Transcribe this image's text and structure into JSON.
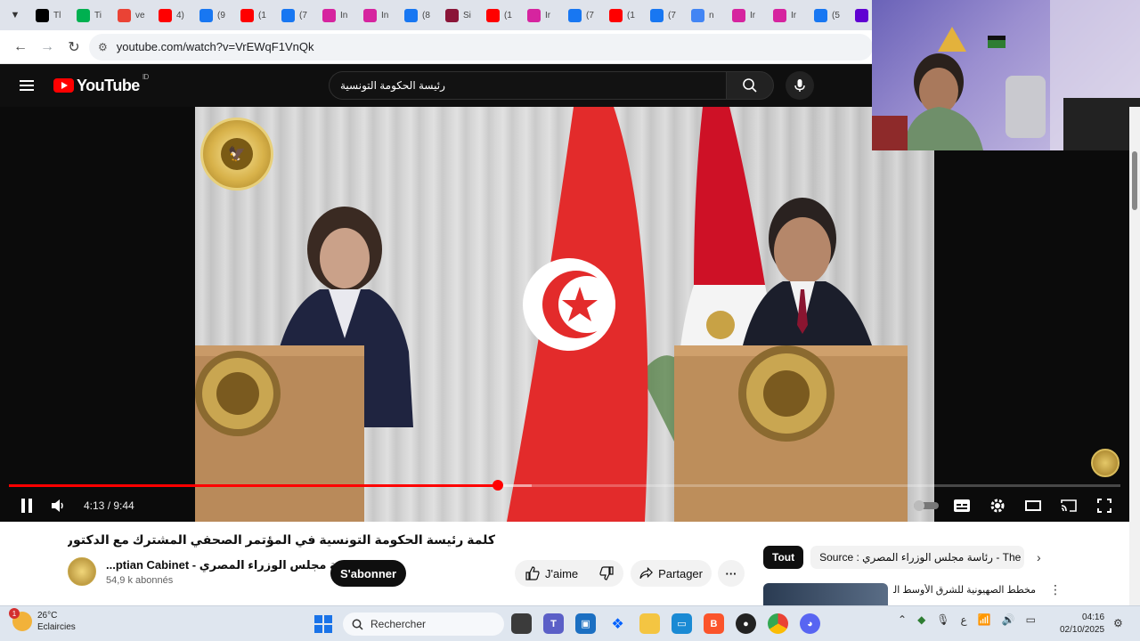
{
  "browser": {
    "tabs": [
      {
        "label": "Tl",
        "icon": "tiktok-icon",
        "color": "#000000"
      },
      {
        "label": "Ti",
        "icon": "k-icon",
        "color": "#00b050"
      },
      {
        "label": "ve",
        "icon": "gmail-icon",
        "color": "#ea4335"
      },
      {
        "label": "4)",
        "icon": "youtube-icon",
        "color": "#ff0000"
      },
      {
        "label": "(9",
        "icon": "facebook-icon",
        "color": "#1877f2"
      },
      {
        "label": "(1",
        "icon": "youtube-icon",
        "color": "#ff0000"
      },
      {
        "label": "(7",
        "icon": "facebook-icon",
        "color": "#1877f2"
      },
      {
        "label": "In",
        "icon": "instagram-icon",
        "color": "#d6249f"
      },
      {
        "label": "In",
        "icon": "instagram-icon",
        "color": "#d6249f"
      },
      {
        "label": "(8",
        "icon": "facebook-icon",
        "color": "#1877f2"
      },
      {
        "label": "Si",
        "icon": "qatar-icon",
        "color": "#8a1538"
      },
      {
        "label": "(1",
        "icon": "youtube-icon",
        "color": "#ff0000"
      },
      {
        "label": "Ir",
        "icon": "instagram-icon",
        "color": "#d6249f"
      },
      {
        "label": "(7",
        "icon": "facebook-icon",
        "color": "#1877f2"
      },
      {
        "label": "(1",
        "icon": "youtube-icon",
        "color": "#ff0000"
      },
      {
        "label": "(7",
        "icon": "facebook-icon",
        "color": "#1877f2"
      },
      {
        "label": "n",
        "icon": "google-icon",
        "color": "#4285f4"
      },
      {
        "label": "Ir",
        "icon": "instagram-icon",
        "color": "#d6249f"
      },
      {
        "label": "Ir",
        "icon": "instagram-icon",
        "color": "#d6249f"
      },
      {
        "label": "(5",
        "icon": "facebook-icon",
        "color": "#1877f2"
      },
      {
        "label": "",
        "icon": "yahoo-icon",
        "color": "#6001d2"
      }
    ],
    "url": "youtube.com/watch?v=VrEWqF1VnQk"
  },
  "youtube": {
    "logo_text": "YouTube",
    "region": "ID",
    "search_query": "رئيسة الحكومة التونسية"
  },
  "player": {
    "time": "4:13 / 9:44",
    "progress": 0.44,
    "buffered": 0.47
  },
  "video": {
    "title": "كلمة رئيسة الحكومة التونسية في المؤتمر الصحفي المشترك مع الدكتور مصطفى مدبولي",
    "channel": "رئاسة مجلس الوزراء المصري - Egyptian Cabinet",
    "channel_display": "...ptian Cabinet - رئاسة مجلس الوزراء المصري",
    "subscribers": "54,9 k abonnés",
    "subscribe_label": "S'abonner",
    "like_label": "J'aime",
    "share_label": "Partager"
  },
  "sidebar": {
    "chips": [
      "Tout",
      "Source : رئاسة مجلس الوزراء المصري - The Egyptia"
    ],
    "rec_title": "مخطط الصهيونية للشرق الأوسط الجديد - ..."
  },
  "taskbar": {
    "weather_temp": "26°C",
    "weather_desc": "Eclaircies",
    "weather_badge": "1",
    "search_label": "Rechercher",
    "lang": "ع",
    "time": "04:16",
    "date": "02/10/2025"
  }
}
